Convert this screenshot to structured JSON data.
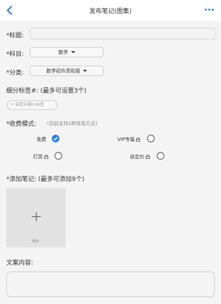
{
  "header": {
    "title": "发布笔记(图集)",
    "back_icon": "chevron-left-icon",
    "more_icon": "more-dots-icon",
    "accent": "#2f7de1"
  },
  "form": {
    "title_label": "*标题:",
    "subject_label": "*科目:",
    "subject_value": "数学",
    "category_label": "*分类:",
    "category_value": "数学初升高衔接",
    "tags_label": "细分标签#: (最多可设置3个)",
    "tags_placeholder": "+ 自定义输入标签",
    "fee_label": "*收费模式:",
    "fee_hint": "(目前支持1种变现方式)",
    "fee_options": [
      {
        "label": "免费",
        "checked": true
      },
      {
        "label": "VIP专属",
        "checked": false
      },
      {
        "label": "打赏",
        "checked": false
      },
      {
        "label": "自定价",
        "checked": false
      }
    ],
    "notes_label": "*添加笔记: (最多可添加9个)",
    "upload_caption": "照片",
    "content_label": "文案内容:"
  }
}
